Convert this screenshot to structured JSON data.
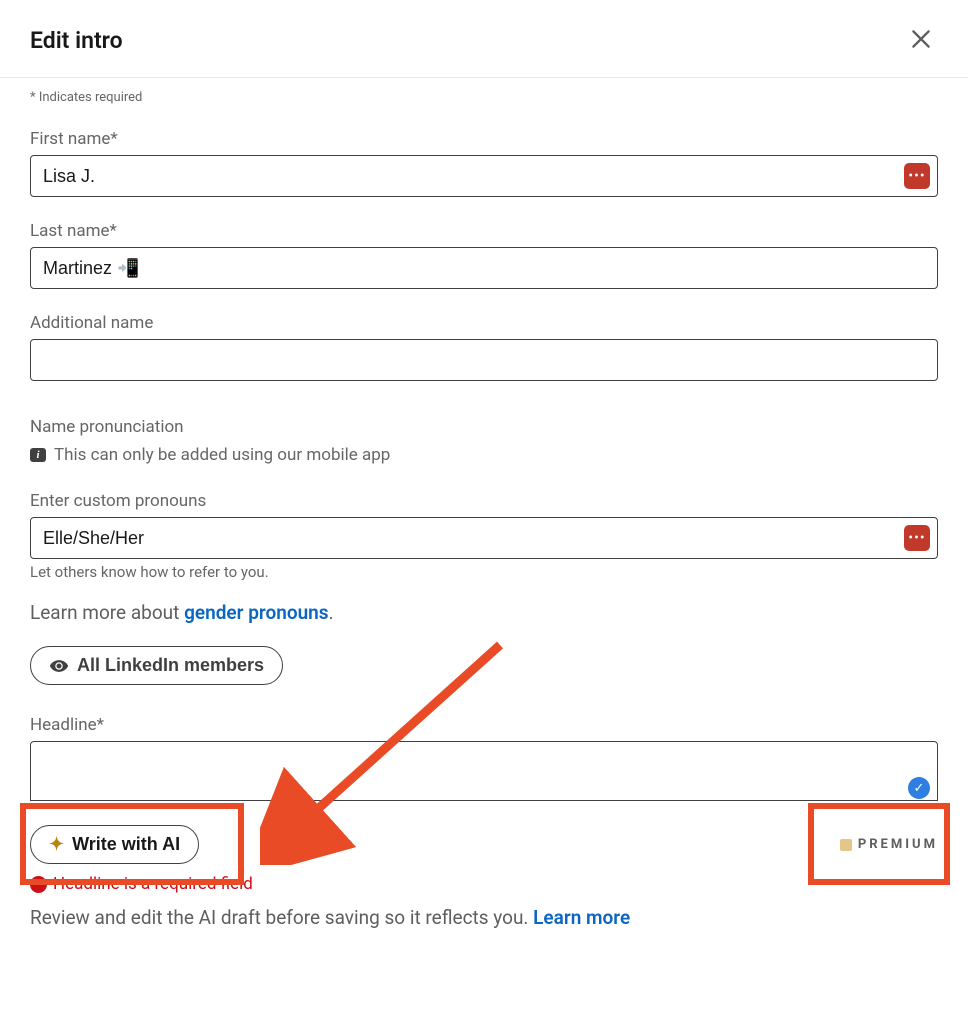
{
  "header": {
    "title": "Edit intro"
  },
  "requiredNote": "* Indicates required",
  "fields": {
    "firstName": {
      "label": "First name*",
      "value": "Lisa J."
    },
    "lastName": {
      "label": "Last name*",
      "value": "Martinez 📲"
    },
    "additionalName": {
      "label": "Additional name",
      "value": ""
    },
    "pronunciation": {
      "label": "Name pronunciation",
      "infoText": "This can only be added using our mobile app"
    },
    "pronouns": {
      "label": "Enter custom pronouns",
      "value": "Elle/She/Her",
      "helper": "Let others know how to refer to you."
    },
    "learnMore": {
      "prefix": "Learn more about ",
      "linkText": "gender pronouns",
      "suffix": "."
    },
    "visibility": {
      "label": "All LinkedIn members"
    },
    "headline": {
      "label": "Headline*",
      "value": "",
      "writeAi": "Write with AI",
      "premium": "PREMIUM",
      "error": "Headline is a required field",
      "review": "Review and edit the AI draft before saving so it reflects you. ",
      "reviewLink": "Learn more"
    }
  }
}
